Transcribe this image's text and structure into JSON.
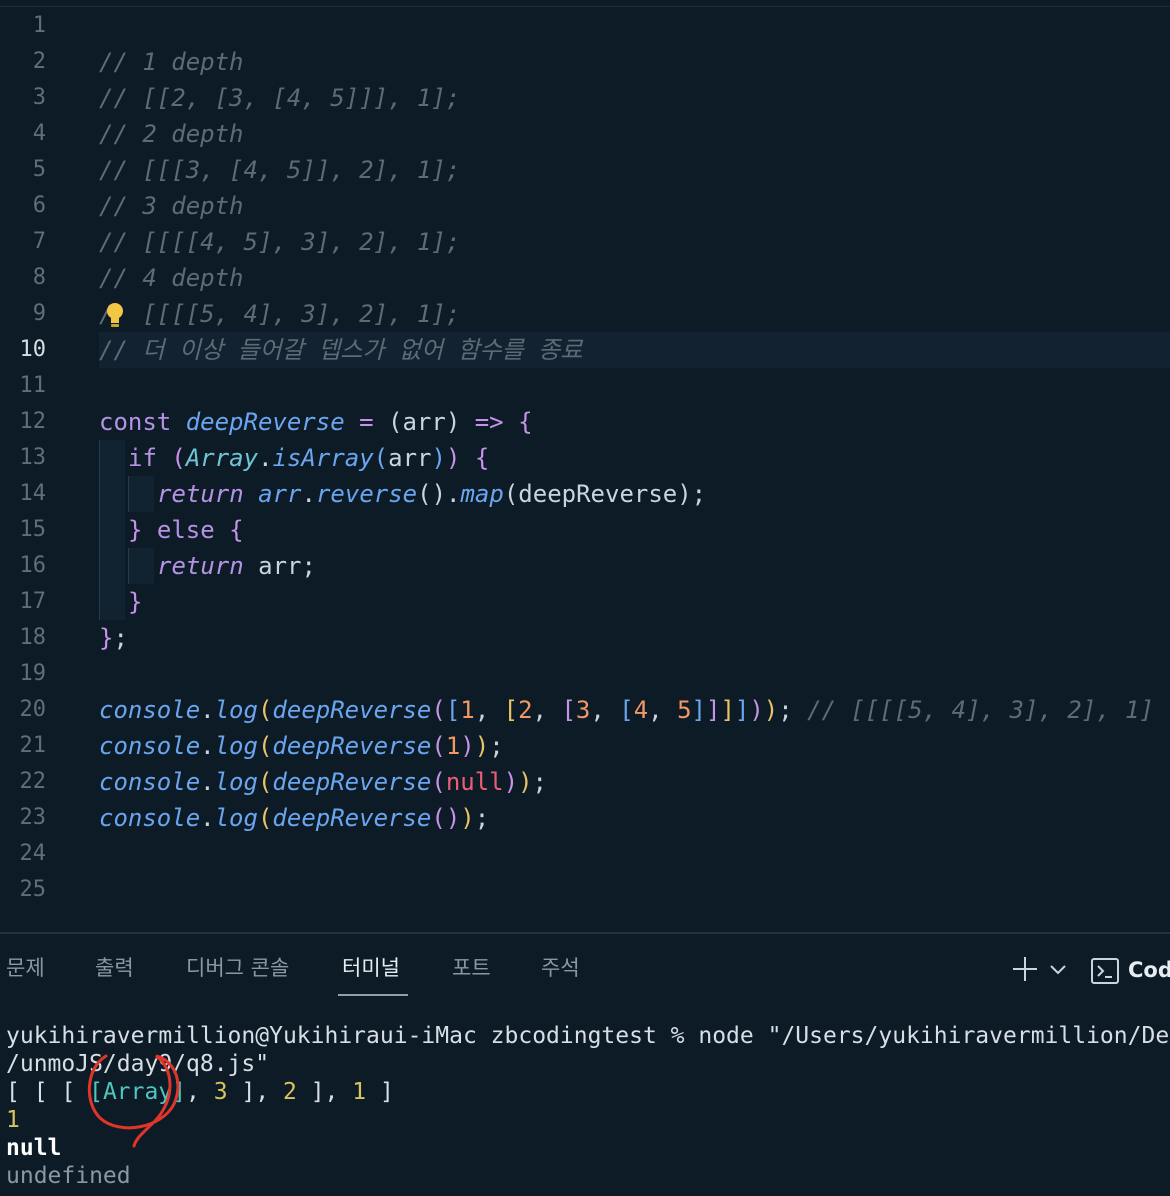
{
  "editor": {
    "active_line": 10,
    "lines": [
      {
        "n": "1",
        "tokens": []
      },
      {
        "n": "2",
        "tokens": [
          {
            "t": "// 1 depth",
            "c": "cm"
          }
        ]
      },
      {
        "n": "3",
        "tokens": [
          {
            "t": "// [[2, [3, [4, 5]]], 1];",
            "c": "cm"
          }
        ]
      },
      {
        "n": "4",
        "tokens": [
          {
            "t": "// 2 depth",
            "c": "cm"
          }
        ]
      },
      {
        "n": "5",
        "tokens": [
          {
            "t": "// [[[3, [4, 5]], 2], 1];",
            "c": "cm"
          }
        ]
      },
      {
        "n": "6",
        "tokens": [
          {
            "t": "// 3 depth",
            "c": "cm"
          }
        ]
      },
      {
        "n": "7",
        "tokens": [
          {
            "t": "// [[[[4, 5], 3], 2], 1];",
            "c": "cm"
          }
        ]
      },
      {
        "n": "8",
        "tokens": [
          {
            "t": "// 4 depth",
            "c": "cm"
          }
        ]
      },
      {
        "n": "9",
        "tokens": [
          {
            "t": "/  [[[[5, 4], 3], 2], 1];",
            "c": "cm"
          }
        ],
        "bulb": true
      },
      {
        "n": "10",
        "tokens": [
          {
            "t": "// 더 이상 들어갈 뎁스가 없어 함수를 종료",
            "c": "cm"
          }
        ]
      },
      {
        "n": "11",
        "tokens": []
      },
      {
        "n": "12",
        "tokens": [
          {
            "t": "const ",
            "c": "kw"
          },
          {
            "t": "deepReverse",
            "c": "fn"
          },
          {
            "t": " = ",
            "c": "op"
          },
          {
            "t": "(",
            "c": "pl"
          },
          {
            "t": "arr",
            "c": "pl"
          },
          {
            "t": ") ",
            "c": "pl"
          },
          {
            "t": "=>",
            "c": "op"
          },
          {
            "t": " ",
            "c": "pl"
          },
          {
            "t": "{",
            "c": "pb"
          }
        ]
      },
      {
        "n": "13",
        "indent": 1,
        "tokens": [
          {
            "t": "if ",
            "c": "kw"
          },
          {
            "t": "(",
            "c": "pb"
          },
          {
            "t": "Array",
            "c": "cls"
          },
          {
            "t": ".",
            "c": "pl"
          },
          {
            "t": "isArray",
            "c": "fn"
          },
          {
            "t": "(",
            "c": "bb"
          },
          {
            "t": "arr",
            "c": "pl"
          },
          {
            "t": ")",
            "c": "bb"
          },
          {
            "t": ")",
            "c": "pb"
          },
          {
            "t": " ",
            "c": "pl"
          },
          {
            "t": "{",
            "c": "pb"
          }
        ]
      },
      {
        "n": "14",
        "indent": 2,
        "tokens": [
          {
            "t": "return ",
            "c": "kwi"
          },
          {
            "t": "arr",
            "c": "fn"
          },
          {
            "t": ".",
            "c": "pl"
          },
          {
            "t": "reverse",
            "c": "fn"
          },
          {
            "t": "()",
            "c": "pl"
          },
          {
            "t": ".",
            "c": "pl"
          },
          {
            "t": "map",
            "c": "fn"
          },
          {
            "t": "(deepReverse);",
            "c": "pl"
          }
        ]
      },
      {
        "n": "15",
        "indent": 1,
        "tokens": [
          {
            "t": "} ",
            "c": "pb"
          },
          {
            "t": "else ",
            "c": "kw"
          },
          {
            "t": "{",
            "c": "pb"
          }
        ]
      },
      {
        "n": "16",
        "indent": 2,
        "tokens": [
          {
            "t": "return ",
            "c": "kwi"
          },
          {
            "t": "arr;",
            "c": "pl"
          }
        ]
      },
      {
        "n": "17",
        "indent": 1,
        "tokens": [
          {
            "t": "}",
            "c": "pb"
          }
        ]
      },
      {
        "n": "18",
        "tokens": [
          {
            "t": "}",
            "c": "pb"
          },
          {
            "t": ";",
            "c": "pl"
          }
        ]
      },
      {
        "n": "19",
        "tokens": []
      },
      {
        "n": "20",
        "tokens": [
          {
            "t": "console",
            "c": "fn"
          },
          {
            "t": ".",
            "c": "pl"
          },
          {
            "t": "log",
            "c": "fn"
          },
          {
            "t": "(",
            "c": "yb"
          },
          {
            "t": "deepReverse",
            "c": "fn"
          },
          {
            "t": "(",
            "c": "pb"
          },
          {
            "t": "[",
            "c": "bb"
          },
          {
            "t": "1",
            "c": "num"
          },
          {
            "t": ", ",
            "c": "pl"
          },
          {
            "t": "[",
            "c": "yb"
          },
          {
            "t": "2",
            "c": "num"
          },
          {
            "t": ", ",
            "c": "pl"
          },
          {
            "t": "[",
            "c": "pb"
          },
          {
            "t": "3",
            "c": "num"
          },
          {
            "t": ", ",
            "c": "pl"
          },
          {
            "t": "[",
            "c": "bb"
          },
          {
            "t": "4",
            "c": "num"
          },
          {
            "t": ", ",
            "c": "pl"
          },
          {
            "t": "5",
            "c": "num"
          },
          {
            "t": "]",
            "c": "bb"
          },
          {
            "t": "]",
            "c": "pb"
          },
          {
            "t": "]",
            "c": "yb"
          },
          {
            "t": "]",
            "c": "bb"
          },
          {
            "t": ")",
            "c": "pb"
          },
          {
            "t": ")",
            "c": "yb"
          },
          {
            "t": "; ",
            "c": "pl"
          },
          {
            "t": "// [[[[5, 4], 3], 2], 1]",
            "c": "cm"
          }
        ]
      },
      {
        "n": "21",
        "tokens": [
          {
            "t": "console",
            "c": "fn"
          },
          {
            "t": ".",
            "c": "pl"
          },
          {
            "t": "log",
            "c": "fn"
          },
          {
            "t": "(",
            "c": "yb"
          },
          {
            "t": "deepReverse",
            "c": "fn"
          },
          {
            "t": "(",
            "c": "pb"
          },
          {
            "t": "1",
            "c": "num"
          },
          {
            "t": ")",
            "c": "pb"
          },
          {
            "t": ")",
            "c": "yb"
          },
          {
            "t": ";",
            "c": "pl"
          }
        ]
      },
      {
        "n": "22",
        "tokens": [
          {
            "t": "console",
            "c": "fn"
          },
          {
            "t": ".",
            "c": "pl"
          },
          {
            "t": "log",
            "c": "fn"
          },
          {
            "t": "(",
            "c": "yb"
          },
          {
            "t": "deepReverse",
            "c": "fn"
          },
          {
            "t": "(",
            "c": "pb"
          },
          {
            "t": "null",
            "c": "nul"
          },
          {
            "t": ")",
            "c": "pb"
          },
          {
            "t": ")",
            "c": "yb"
          },
          {
            "t": ";",
            "c": "pl"
          }
        ]
      },
      {
        "n": "23",
        "tokens": [
          {
            "t": "console",
            "c": "fn"
          },
          {
            "t": ".",
            "c": "pl"
          },
          {
            "t": "log",
            "c": "fn"
          },
          {
            "t": "(",
            "c": "yb"
          },
          {
            "t": "deepReverse",
            "c": "fn"
          },
          {
            "t": "()",
            "c": "pb"
          },
          {
            "t": ")",
            "c": "yb"
          },
          {
            "t": ";",
            "c": "pl"
          }
        ]
      },
      {
        "n": "24",
        "tokens": []
      },
      {
        "n": "25",
        "tokens": []
      }
    ]
  },
  "panel": {
    "tabs": [
      "문제",
      "출력",
      "디버그 콘솔",
      "터미널",
      "포트",
      "주석"
    ],
    "active_tab": "터미널",
    "add_icon": "plus-icon",
    "dropdown_icon": "chevron-down-icon",
    "terminal_icon": "terminal-icon",
    "terminal_label": "Cod"
  },
  "terminal": {
    "lines": [
      [
        {
          "t": "yukihiravermillion@Yukihiraui-iMac zbcodingtest % node \"/Users/yukihiravermillion/De",
          "c": ""
        }
      ],
      [
        {
          "t": "/unmoJS/day9/q8.js\"",
          "c": ""
        }
      ],
      [
        {
          "t": "[ [ [ ",
          "c": ""
        },
        {
          "t": "[Array]",
          "c": "t-cyan"
        },
        {
          "t": ", ",
          "c": ""
        },
        {
          "t": "3",
          "c": "t-yellow"
        },
        {
          "t": " ], ",
          "c": ""
        },
        {
          "t": "2",
          "c": "t-yellow"
        },
        {
          "t": " ], ",
          "c": ""
        },
        {
          "t": "1",
          "c": "t-yellow"
        },
        {
          "t": " ]",
          "c": ""
        }
      ],
      [
        {
          "t": "1",
          "c": "t-yellow"
        }
      ],
      [
        {
          "t": "null",
          "c": "t-bold"
        }
      ],
      [
        {
          "t": "undefined",
          "c": "t-dim"
        }
      ]
    ]
  },
  "colors": {
    "background": "#0d1b26",
    "annotation_circle": "#e0352b"
  }
}
